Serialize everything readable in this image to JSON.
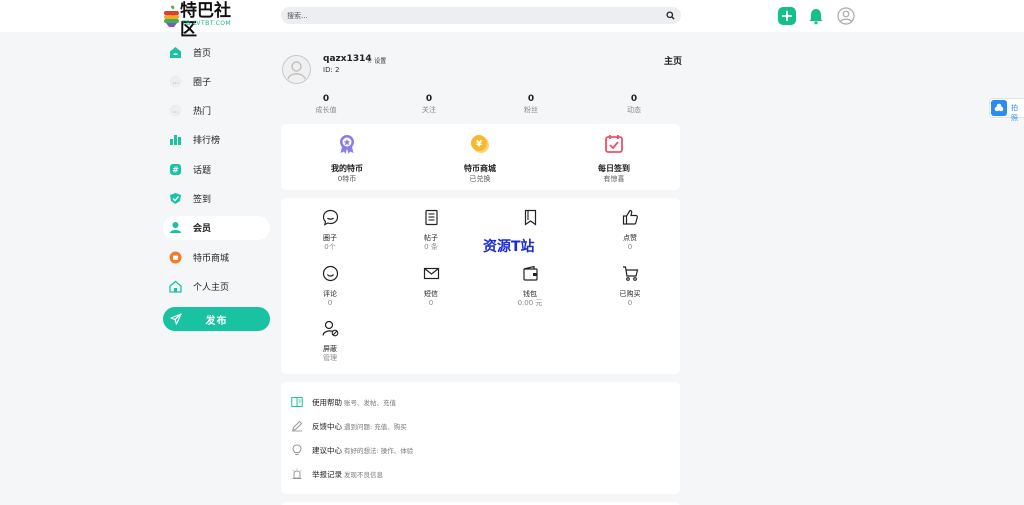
{
  "header": {
    "logo_text": "特巴社区",
    "logo_sub": "TB.LVTBT.COM",
    "search_placeholder": "搜索..."
  },
  "sidebar": {
    "items": [
      {
        "label": "首页",
        "icon": "home-icon"
      },
      {
        "label": "圈子",
        "icon": "dots-icon"
      },
      {
        "label": "热门",
        "icon": "dots-icon"
      },
      {
        "label": "排行榜",
        "icon": "ranking-icon"
      },
      {
        "label": "话题",
        "icon": "topic-icon"
      },
      {
        "label": "签到",
        "icon": "checkin-icon"
      },
      {
        "label": "会员",
        "icon": "member-icon",
        "active": true
      },
      {
        "label": "特币商城",
        "icon": "shop-icon"
      },
      {
        "label": "个人主页",
        "icon": "profile-home-icon"
      }
    ],
    "publish_label": "发布"
  },
  "profile": {
    "username": "qazx1314",
    "settings_label": "☆ 设置",
    "user_id": "ID: 2",
    "homepage_label": "主页"
  },
  "stats": [
    {
      "value": "0",
      "label": "成长值"
    },
    {
      "value": "0",
      "label": "关注"
    },
    {
      "value": "0",
      "label": "粉丝"
    },
    {
      "value": "0",
      "label": "动态"
    }
  ],
  "features": [
    {
      "title": "我的特币",
      "sub": "0特币",
      "icon": "badge-icon"
    },
    {
      "title": "特币商城",
      "sub": "已兑换",
      "icon": "coin-icon"
    },
    {
      "title": "每日签到",
      "sub": "有惊喜",
      "icon": "calendar-icon"
    }
  ],
  "grid": [
    {
      "title": "圈子",
      "sub": "0个",
      "icon": "chat-icon"
    },
    {
      "title": "帖子",
      "sub": "0 条",
      "icon": "document-icon"
    },
    {
      "title": "",
      "sub": "",
      "icon": "bookmark-icon"
    },
    {
      "title": "点赞",
      "sub": "0",
      "icon": "thumbs-up-icon"
    },
    {
      "title": "评论",
      "sub": "0",
      "icon": "smile-icon"
    },
    {
      "title": "短信",
      "sub": "0",
      "icon": "mail-icon"
    },
    {
      "title": "钱包",
      "sub": "0.00 元",
      "icon": "wallet-icon"
    },
    {
      "title": "已购买",
      "sub": "0",
      "icon": "cart-icon"
    },
    {
      "title": "屏蔽",
      "sub": "管理",
      "icon": "block-user-icon"
    }
  ],
  "watermark": "资源T站",
  "help": [
    {
      "title": "使用帮助",
      "desc": "账号、发帖、充值",
      "icon": "book-icon"
    },
    {
      "title": "反馈中心",
      "desc": "遇到问题: 充值、购买",
      "icon": "pencil-icon"
    },
    {
      "title": "建议中心",
      "desc": "有好的想法: 操作、体验",
      "icon": "bulb-icon"
    },
    {
      "title": "举报记录",
      "desc": "发现不良信息",
      "icon": "alarm-icon"
    }
  ],
  "side_tab_label": "拍照",
  "colors": {
    "accent": "#19c2a0",
    "primary_green": "#12c08a",
    "watermark": "#1a2bd6"
  }
}
